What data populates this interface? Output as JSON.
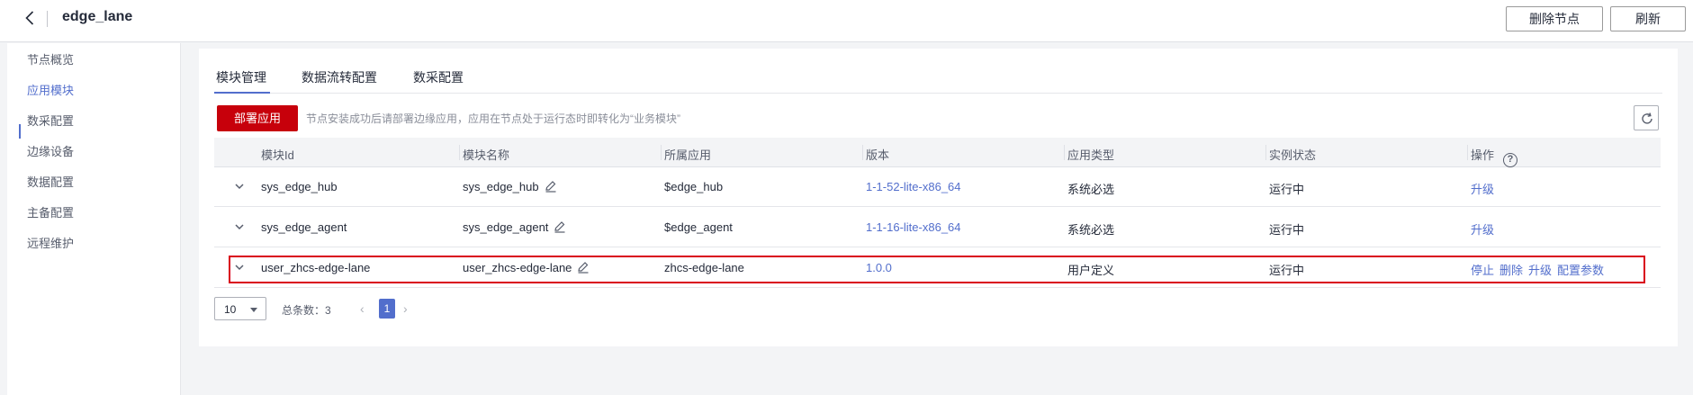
{
  "header": {
    "title": "edge_lane",
    "delete_node_label": "删除节点",
    "refresh_label": "刷新"
  },
  "sidebar": {
    "items": [
      {
        "label": "节点概览"
      },
      {
        "label": "应用模块"
      },
      {
        "label": "数采配置"
      },
      {
        "label": "边缘设备"
      },
      {
        "label": "数据配置"
      },
      {
        "label": "主备配置"
      },
      {
        "label": "远程维护"
      }
    ],
    "active": "应用模块"
  },
  "tabs": [
    {
      "label": "模块管理"
    },
    {
      "label": "数据流转配置"
    },
    {
      "label": "数采配置"
    }
  ],
  "toolbar": {
    "deploy_label": "部署应用",
    "hint": "节点安装成功后请部署边缘应用，应用在节点处于运行态时即转化为“业务模块”"
  },
  "table": {
    "columns": [
      "模块Id",
      "模块名称",
      "所属应用",
      "版本",
      "应用类型",
      "实例状态",
      "操作"
    ],
    "rows": [
      {
        "id": "sys_edge_hub",
        "name": "sys_edge_hub",
        "app": "$edge_hub",
        "version": "1-1-52-lite-x86_64",
        "type": "系统必选",
        "status": "运行中",
        "ops": [
          "升级"
        ]
      },
      {
        "id": "sys_edge_agent",
        "name": "sys_edge_agent",
        "app": "$edge_agent",
        "version": "1-1-16-lite-x86_64",
        "type": "系统必选",
        "status": "运行中",
        "ops": [
          "升级"
        ]
      },
      {
        "id": "user_zhcs-edge-lane",
        "name": "user_zhcs-edge-lane",
        "app": "zhcs-edge-lane",
        "version": "1.0.0",
        "type": "用户定义",
        "status": "运行中",
        "ops": [
          "停止",
          "删除",
          "升级",
          "配置参数"
        ]
      }
    ]
  },
  "pager": {
    "page_size": "10",
    "total_label": "总条数：3",
    "current_page": "1"
  },
  "icons": {
    "back": "chevron-left-icon",
    "edit": "pencil-icon",
    "help": "question-circle-icon",
    "refresh": "refresh-icon",
    "expand": "chevron-down-icon"
  },
  "colors": {
    "primary_red": "#c7000b",
    "link_blue": "#526ecc",
    "highlight": "#d9001b"
  }
}
